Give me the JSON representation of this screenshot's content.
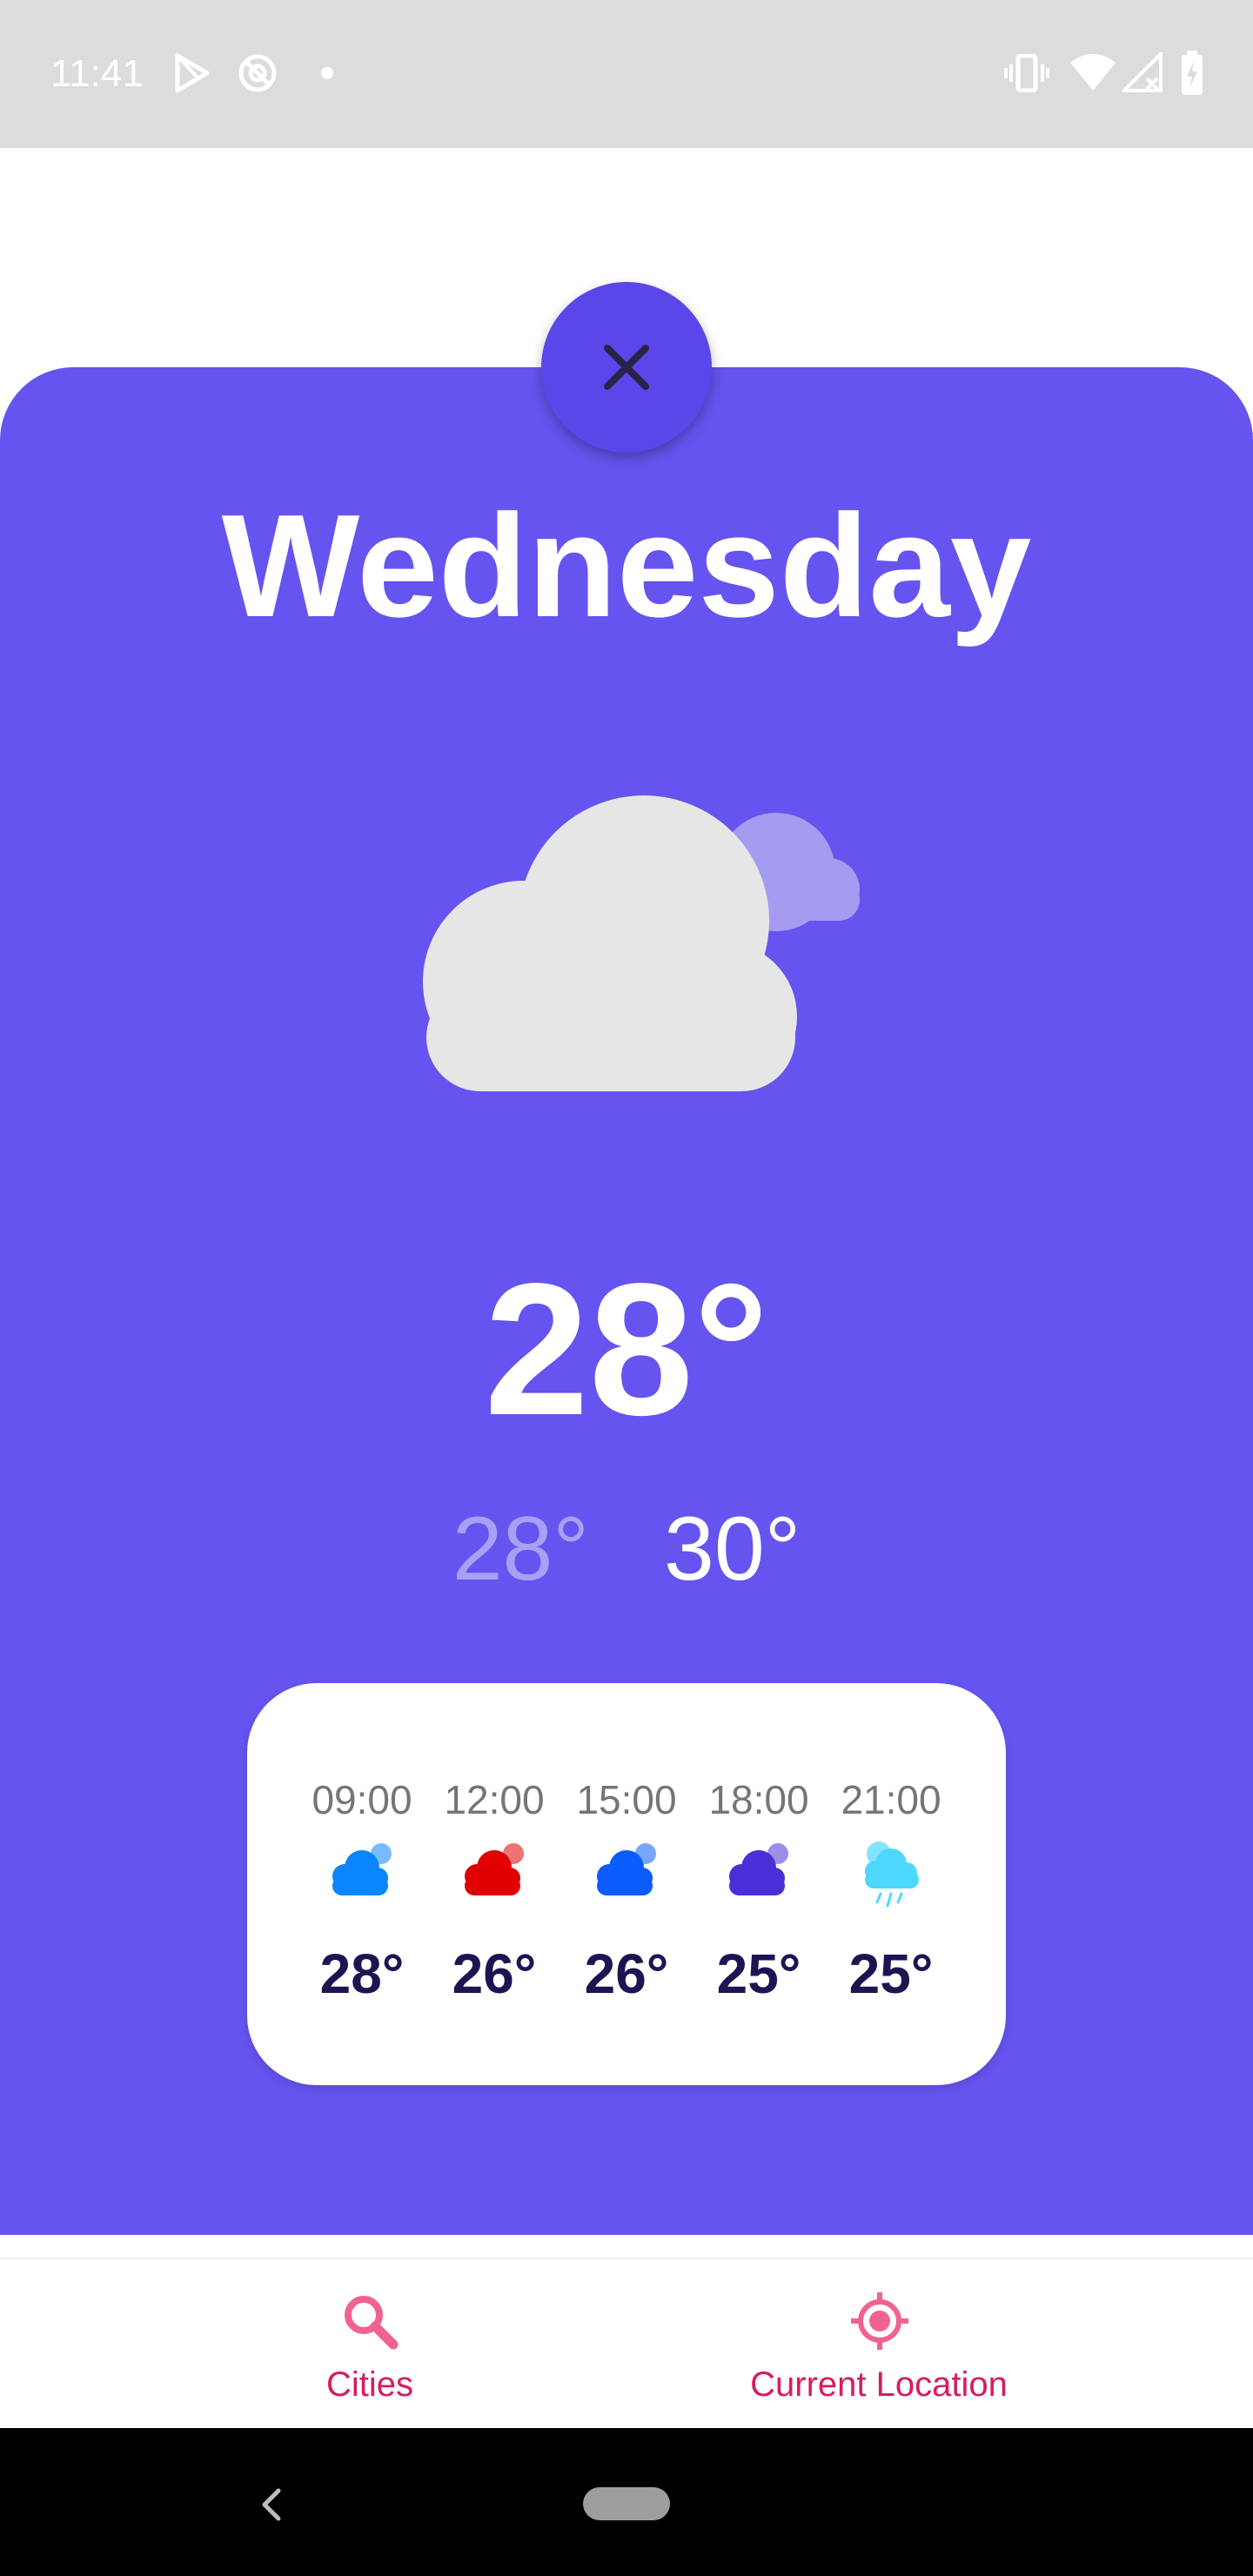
{
  "status_bar": {
    "time": "11:41",
    "left_icons": [
      "play-store-icon",
      "sync-icon",
      "dot-icon"
    ],
    "right_icons": [
      "vibrate-icon",
      "wifi-icon",
      "signal-icon",
      "battery-charging-icon"
    ]
  },
  "forecast": {
    "day": "Wednesday",
    "icon": "cloudy-icon",
    "temperature": "28°",
    "min_temperature": "28°",
    "max_temperature": "30°",
    "hourly": [
      {
        "time": "09:00",
        "temp": "28°",
        "icon": "cloud-icon",
        "color": "#0a84ff"
      },
      {
        "time": "12:00",
        "temp": "26°",
        "icon": "cloud-icon",
        "color": "#e00000"
      },
      {
        "time": "15:00",
        "temp": "26°",
        "icon": "cloud-icon",
        "color": "#0a5cff"
      },
      {
        "time": "18:00",
        "temp": "25°",
        "icon": "cloud-icon",
        "color": "#4a2fd8"
      },
      {
        "time": "21:00",
        "temp": "25°",
        "icon": "rain-icon",
        "color": "#4dd8ff"
      }
    ]
  },
  "bottom_nav": {
    "items": [
      {
        "label": "Cities",
        "icon": "search-icon"
      },
      {
        "label": "Current Location",
        "icon": "location-target-icon"
      }
    ]
  },
  "colors": {
    "card_background": "#6554ef",
    "close_button": "#5a47ea",
    "nav_accent": "#d81b60",
    "nav_icon": "#f06292",
    "hour_temp": "#1b1553"
  }
}
